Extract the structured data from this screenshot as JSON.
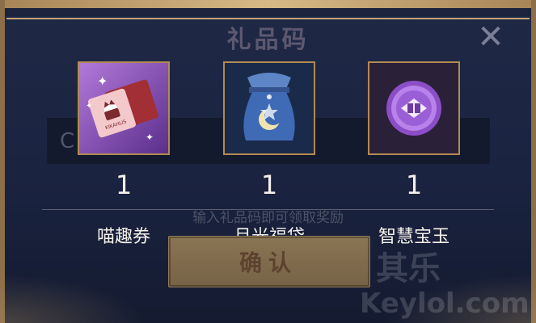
{
  "dialog": {
    "title": "礼品码",
    "input_value": "C",
    "hint": "输入礼品码即可领取奖励",
    "confirm_label": "确认"
  },
  "items": [
    {
      "name": "喵趣券",
      "qty": "1",
      "ticket_text": "KIKAHLIS"
    },
    {
      "name": "月光福袋",
      "qty": "1"
    },
    {
      "name": "智慧宝玉",
      "qty": "1"
    }
  ],
  "watermark": {
    "cn": "其乐",
    "en": "Keylol.com"
  }
}
